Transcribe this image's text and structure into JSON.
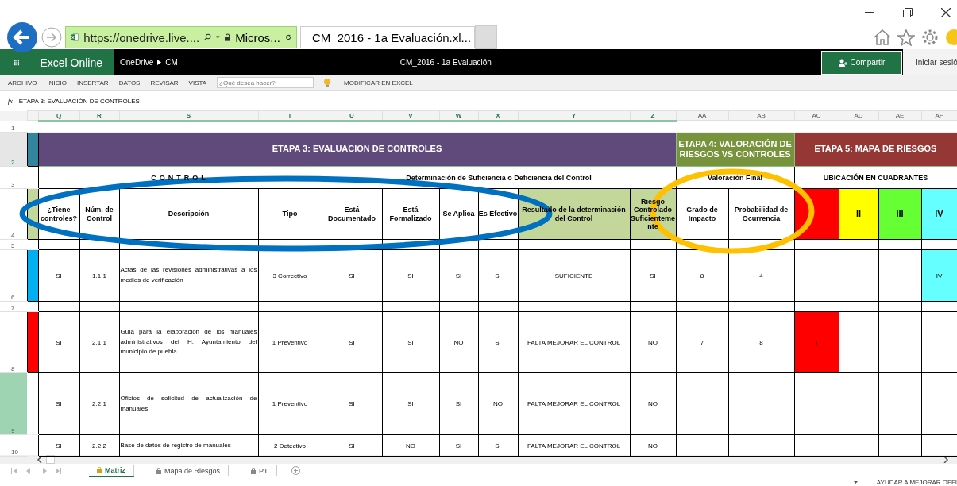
{
  "browser": {
    "address": "https://onedrive.live....",
    "site": "Micros...",
    "tab": {
      "title": "CM_2016 - 1a Evaluación.xl...",
      "selected": true
    }
  },
  "app": {
    "name": "Excel Online",
    "breadcrumb": [
      "OneDrive",
      "CM"
    ],
    "document_title": "CM_2016 - 1a Evaluación",
    "share_button": "Compartir",
    "sign_in": "Iniciar sesió"
  },
  "ribbon": {
    "tabs": [
      "ARCHIVO",
      "INICIO",
      "INSERTAR",
      "DATOS",
      "REVISAR",
      "VISTA"
    ],
    "search": {
      "placeholder": "¿Qué desea hacer?"
    },
    "edit_button": "MODIFICAR EN EXCEL"
  },
  "formula_bar": {
    "label": "fx",
    "value": "ETAPA 3: EVALUACIÓN DE CONTROLES"
  },
  "sheet": {
    "columns": [
      "Q",
      "R",
      "S",
      "T",
      "U",
      "V",
      "W",
      "X",
      "Y",
      "Z",
      "AA",
      "AB",
      "AC",
      "AD",
      "AE",
      "AF"
    ],
    "top_row": "1",
    "stage_row": {
      "row": "2",
      "color": "#31859c",
      "stages": [
        {
          "title": "ETAPA 3: EVALUACION DE CONTROLES",
          "color": "#604a7b"
        },
        {
          "title": "ETAPA 4: VALORACIÓN DE RIESGOS VS CONTROLES",
          "color": "#77933c"
        },
        {
          "title": "ETAPA 5: MAPA DE RIESGOS",
          "color": "#953735"
        }
      ]
    },
    "group_row": {
      "row": "3",
      "groups": [
        {
          "title": "CONTROL"
        },
        {
          "title": "Determinación de Suficiencia o Deficiencia del Control"
        },
        {
          "title": "Valoración Final"
        },
        {
          "title": "UBICACIÓN EN CUADRANTES"
        }
      ]
    },
    "header_row": {
      "row": "4",
      "color": "#c4d79b",
      "headers": [
        {
          "text": "¿Tiene controles?"
        },
        {
          "text": "Núm. de Control"
        },
        {
          "text": "Descripción"
        },
        {
          "text": "Tipo"
        },
        {
          "text": "Está Documentado"
        },
        {
          "text": "Está Formalizado"
        },
        {
          "text": "Se Aplica"
        },
        {
          "text": "Es Efectivo"
        },
        {
          "text": "Resultado de la determinación del Control",
          "color": "#c4d79b"
        },
        {
          "text": "Riesgo Controlado Suficientemente",
          "color": "#c4d79b"
        },
        {
          "text": "Grado de Impacto"
        },
        {
          "text": "Probabilidad de Ocurrencia"
        },
        {
          "color": "#ff0000"
        },
        {
          "text": "II",
          "color": "#ffff00"
        },
        {
          "text": "III",
          "color": "#66ff33"
        },
        {
          "text": "IV",
          "color": "#66ffff"
        }
      ]
    },
    "rows": [
      {
        "row": "5",
        "kind": "spacer",
        "selected": false
      },
      {
        "row": "6",
        "kind": "data",
        "selected": false,
        "color": "#00b0f0",
        "cells": [
          "SI",
          "1.1.1",
          "Actas de las revisiones administrativas a los medios de verificación",
          "3 Correctivo",
          "SI",
          "SI",
          "SI",
          "SI",
          "SUFICIENTE",
          "SI",
          "8",
          "4",
          null,
          null,
          null,
          {
            "label": "IV",
            "color": "#66ffff"
          }
        ]
      },
      {
        "row": "7",
        "kind": "spacer",
        "selected": false
      },
      {
        "row": "8",
        "kind": "data",
        "selected": false,
        "color": "#ff0000",
        "cells": [
          "SI",
          "2.1.1",
          "Guía para la elaboración de los manuales administrativos del H. Ayuntamiento del municipio de puebla",
          "1 Preventivo",
          "SI",
          "SI",
          "NO",
          "SI",
          "FALTA MEJORAR EL CONTROL",
          "NO",
          "7",
          "8",
          {
            "label": "I",
            "color": "#ff0000"
          }
        ]
      },
      {
        "row": "9",
        "kind": "data",
        "selected": true,
        "cells": [
          "SI",
          "2.2.1",
          "Oficios de solicitud de actualización de manuales",
          "1 Preventivo",
          "SI",
          "SI",
          "SI",
          "NO",
          "FALTA MEJORAR EL CONTROL",
          "NO",
          null,
          null
        ]
      },
      {
        "row": "10",
        "kind": "data",
        "selected": false,
        "cells": [
          "SI",
          "2.2.2",
          "Base de datos de registro de manuales",
          "2 Detectivo",
          "SI",
          "NO",
          "SI",
          "SI",
          "FALTA MEJORAR EL CONTROL",
          "NO",
          null,
          null
        ]
      }
    ]
  },
  "annotations": [
    {
      "kind": "ellipse",
      "color": "#0070c0"
    },
    {
      "kind": "ellipse",
      "color": "#ffc000"
    }
  ],
  "sheet_tabs": [
    {
      "label": "Matriz",
      "selected": true
    },
    {
      "label": "Mapa de Riesgos",
      "selected": false
    },
    {
      "label": "PT",
      "selected": false
    }
  ],
  "status": "AYUDAR A MEJORAR OFFI"
}
